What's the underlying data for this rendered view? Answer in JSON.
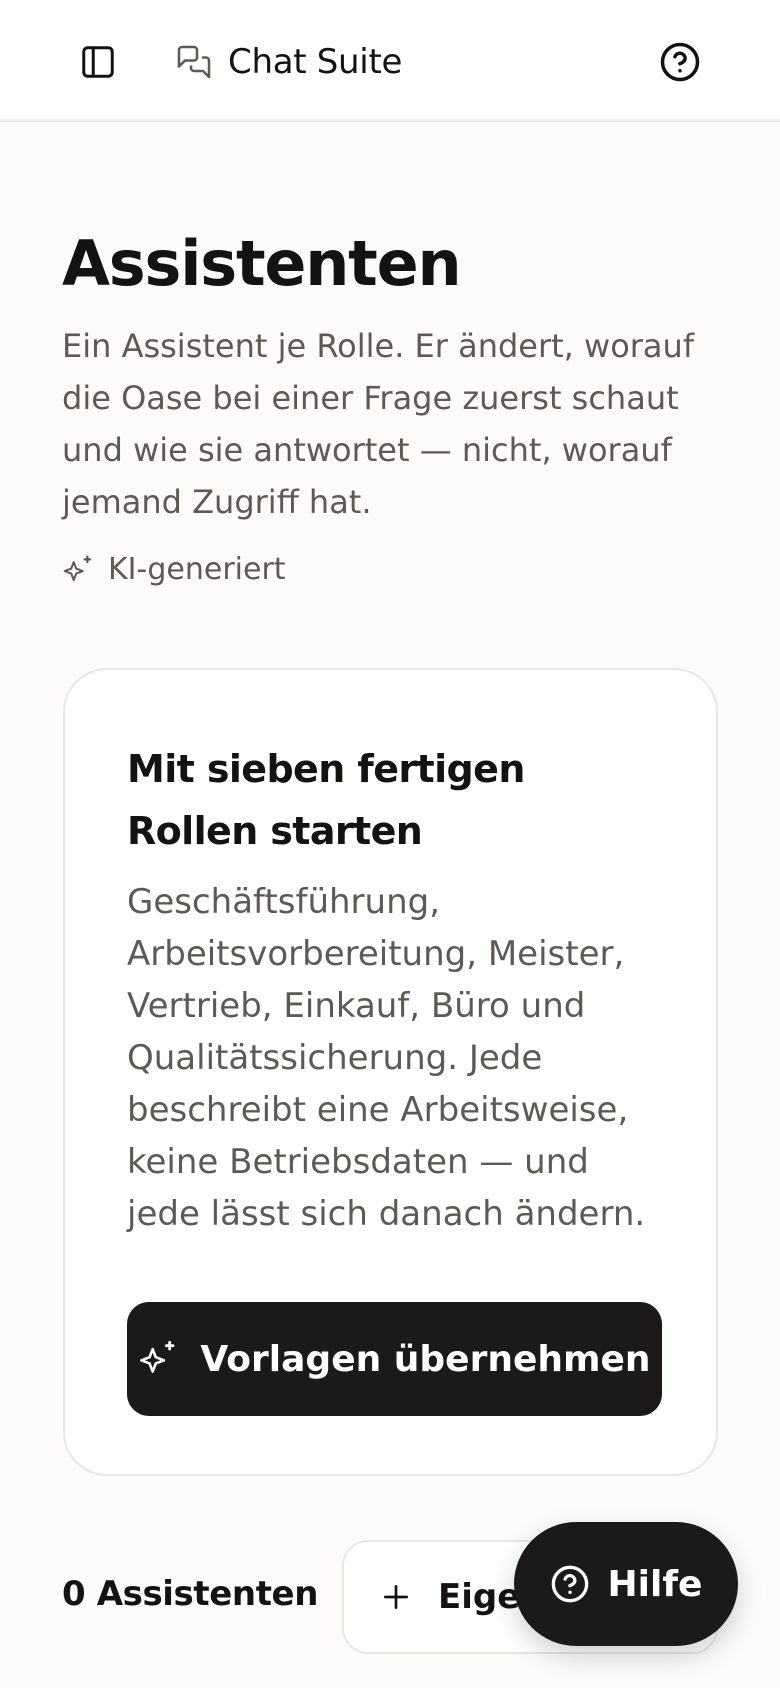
{
  "header": {
    "app_title": "Chat Suite",
    "icons": {
      "sidebar_toggle": "sidebar-toggle-icon",
      "brand": "chat-bubbles-icon",
      "help": "help-circle-icon"
    }
  },
  "main": {
    "title": "Assistenten",
    "description": "Ein Assistent je Rolle. Er ändert, worauf die Oase bei einer Frage zuerst schaut und wie sie antwortet — nicht, worauf jemand Zugriff hat.",
    "ai_tag": {
      "label": "KI-generiert",
      "icon": "sparkles-icon"
    }
  },
  "template_card": {
    "title": "Mit sieben fertigen Rollen starten",
    "description": "Geschäftsführung, Arbeitsvorbereitung, Meister, Vertrieb, Einkauf, Büro und Qualitätssicherung. Jede beschreibt eine Arbeitsweise, keine Betriebsdaten — und jede lässt sich danach ändern.",
    "button_label": "Vorlagen übernehmen",
    "button_icon": "sparkles-icon"
  },
  "list_header": {
    "count_label": "0 Assistenten",
    "create_button_label": "Eigen",
    "create_button_icon": "plus-icon"
  },
  "help_fab": {
    "label": "Hilfe",
    "icon": "help-circle-icon"
  },
  "colors": {
    "background": "#fcfbfa",
    "surface": "#ffffff",
    "primary": "#1b1a18",
    "text": "#141311",
    "muted_text": "#5d5a56",
    "border": "#e9e7e3"
  }
}
